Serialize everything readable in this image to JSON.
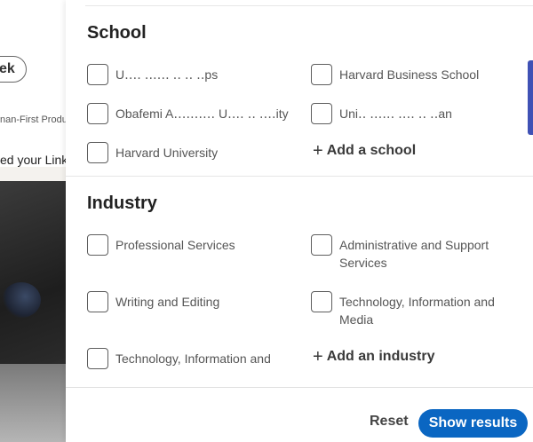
{
  "background": {
    "pill_label": "ek",
    "subtitle": "nan-First Produ",
    "text": "ed your Link"
  },
  "school": {
    "title": "School",
    "options": [
      {
        "label": "U‥‥ ‥‥‥ ‥ ‥ ‥ps"
      },
      {
        "label": "Harvard Business School"
      },
      {
        "label": "Obafemi A‥‥‥‥‥ U‥‥ ‥ ‥‥ity"
      },
      {
        "label": "Uni‥ ‥‥‥ ‥‥ ‥ ‥an"
      },
      {
        "label": "Harvard University"
      }
    ],
    "add_label": "Add a school"
  },
  "industry": {
    "title": "Industry",
    "options": [
      {
        "label": "Professional Services"
      },
      {
        "label": "Administrative and Support Services"
      },
      {
        "label": "Writing and Editing"
      },
      {
        "label": "Technology, Information and Media"
      },
      {
        "label": "Technology, Information and"
      }
    ],
    "add_label": "Add an industry"
  },
  "footer": {
    "reset_label": "Reset",
    "show_results_label": "Show results"
  },
  "colors": {
    "primary": "#0a66c2",
    "accent_bar": "#3f51b5"
  }
}
